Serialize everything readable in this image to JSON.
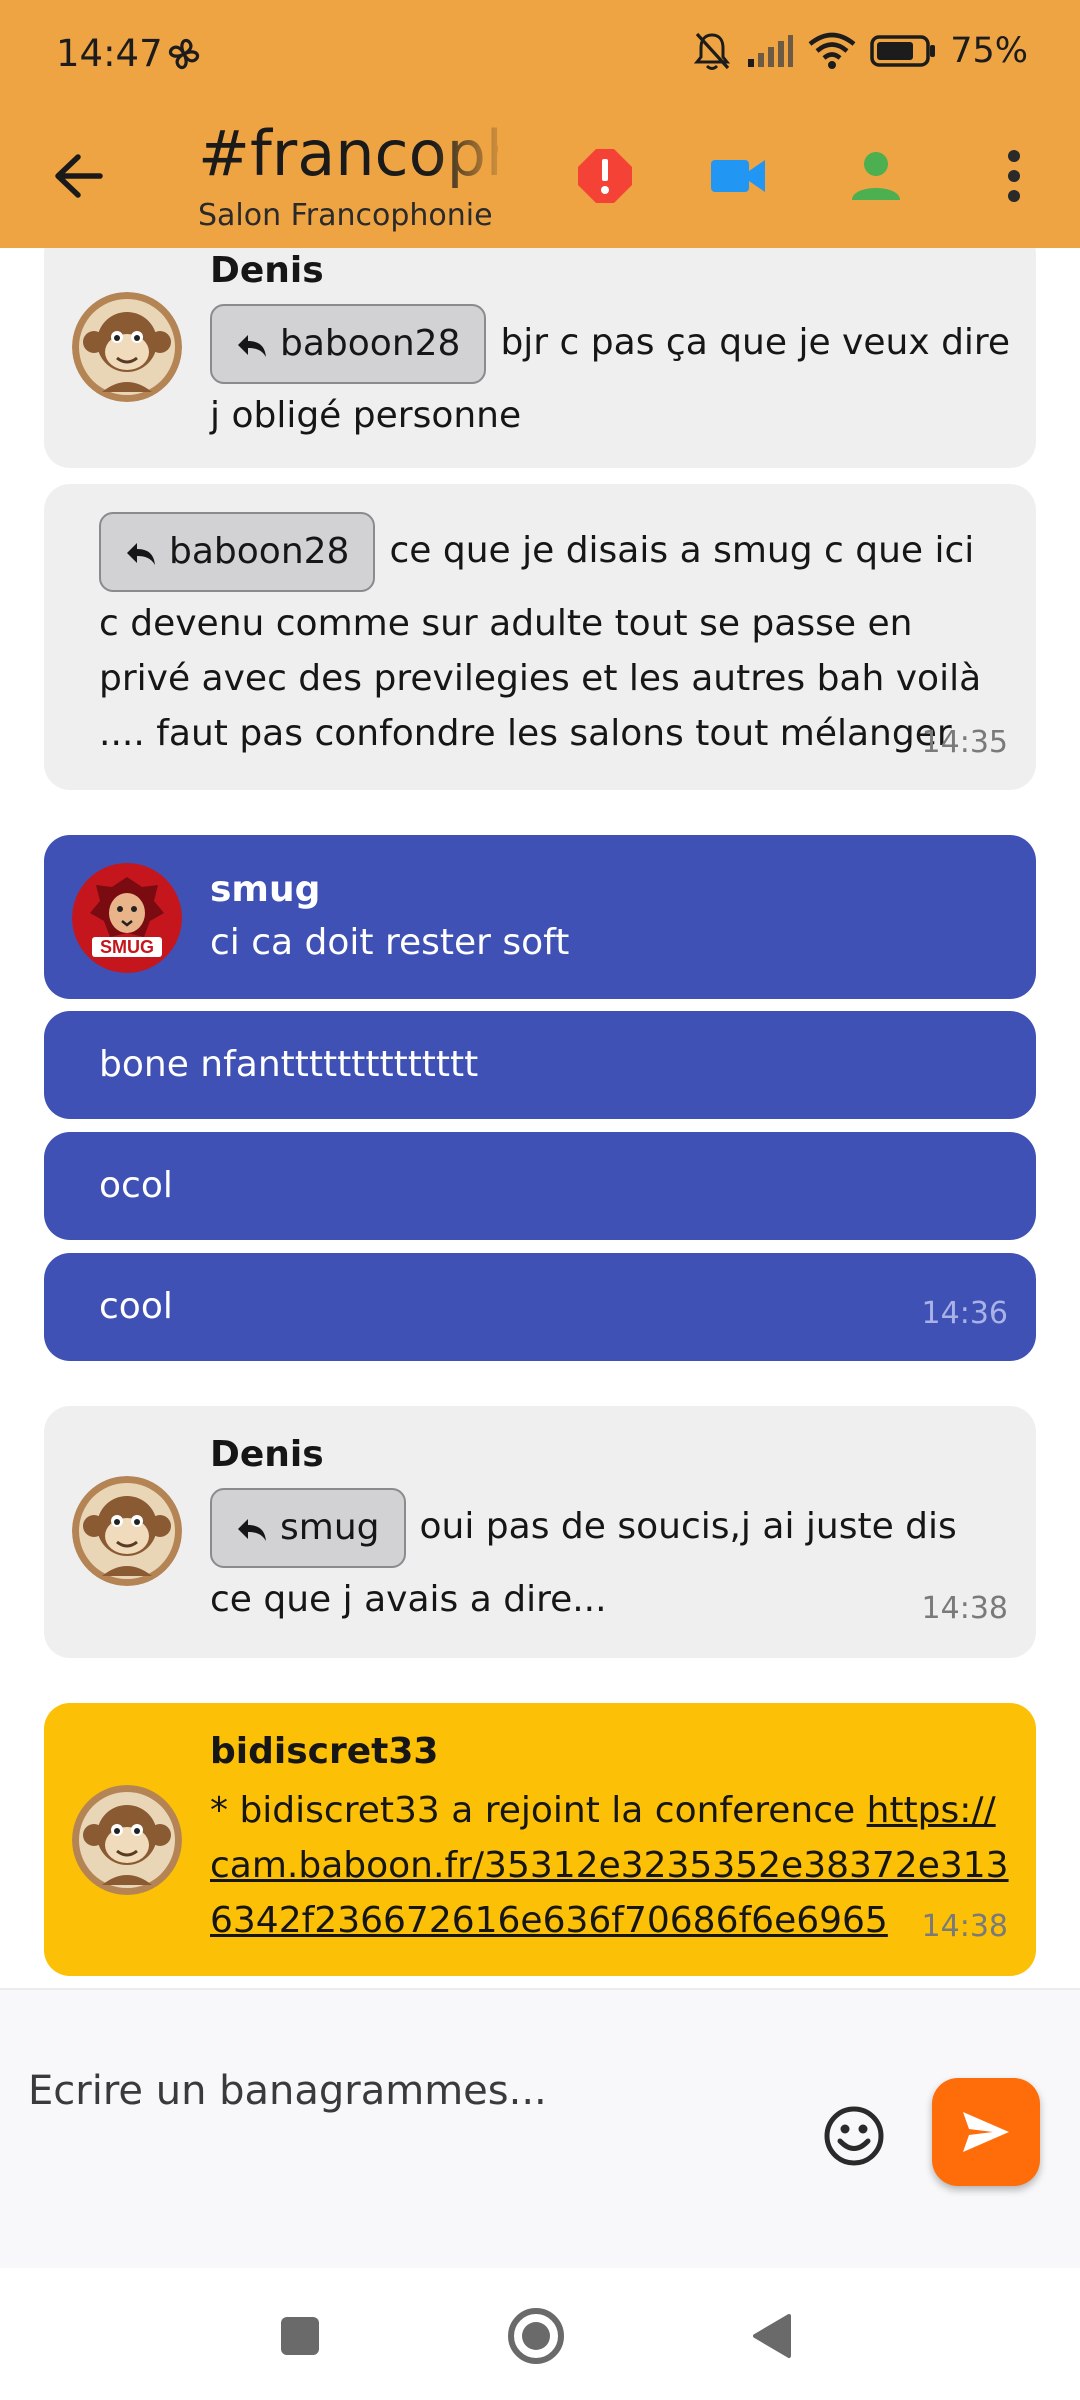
{
  "status_bar": {
    "time": "14:47",
    "battery_percent": "75%"
  },
  "header": {
    "title": "#francophonie",
    "subtitle": "Salon Francophonie",
    "icons": [
      "back-arrow",
      "alert",
      "video-camera",
      "user",
      "more-vert"
    ],
    "colors": {
      "bar": "#EFA443",
      "alert": "#F44336",
      "video": "#2196F3",
      "user": "#4CAF50"
    }
  },
  "messages": [
    {
      "author": "Denis",
      "reply_to": "baboon28",
      "text_line1": "bjr c pas ça que je veux dire",
      "text_line2": "j obligé personne"
    },
    {
      "reply_to": "baboon28",
      "text_line1": "ce que je disais a smug c que ici",
      "text_rest": "c devenu comme sur adulte tout se passe en privé avec des previlegies et les autres bah voilà .... faut pas confondre les salons tout mélanger",
      "time": "14:35"
    },
    {
      "author": "smug",
      "text": "ci ca doit rester soft",
      "avatar_label": "SMUG"
    },
    {
      "text": "bone nfantttttttttttttt"
    },
    {
      "text": "ocol"
    },
    {
      "text": "cool",
      "time": "14:36"
    },
    {
      "author": "Denis",
      "reply_to": "smug",
      "text_line1": "oui pas de soucis,j ai juste dis",
      "text_line2": "ce que j avais a dire...",
      "time": "14:38"
    },
    {
      "author": "bidiscret33",
      "text_prefix": "* bidiscret33 a rejoint la conference ",
      "link_line1": "https://",
      "link_line2": "cam.baboon.fr/35312e3235352e38372e313",
      "link_line3": "6342f236672616e636f70686f6e6965",
      "time": "14:38"
    }
  ],
  "composer": {
    "placeholder": "Ecrire un banagrammes...",
    "send_color": "#FF6D0A"
  },
  "bubble_colors": {
    "grey": "#EFEFF0",
    "blue": "#3F51B5",
    "gold": "#FCC006"
  }
}
